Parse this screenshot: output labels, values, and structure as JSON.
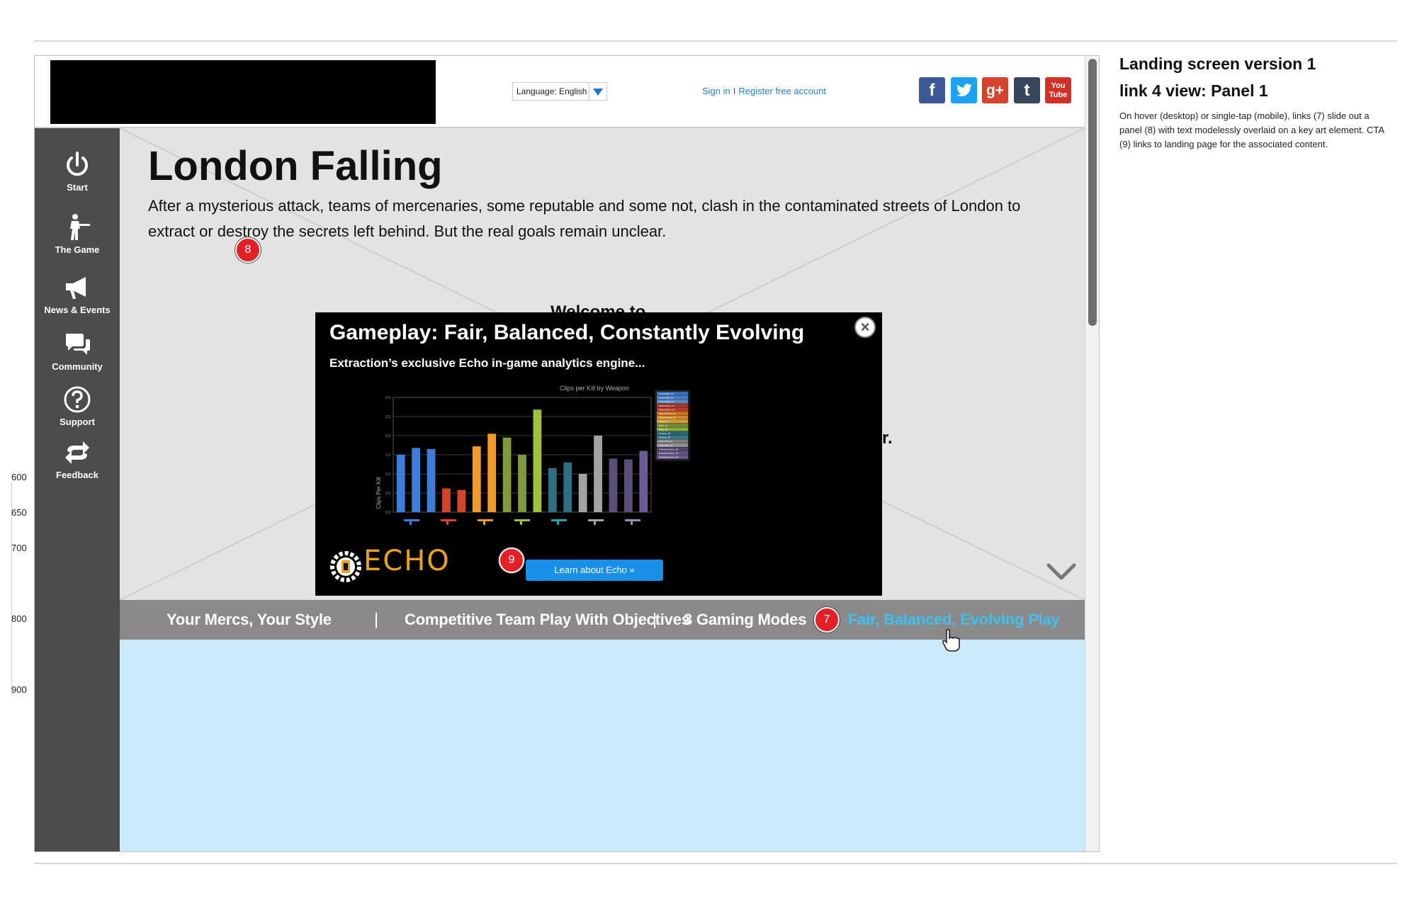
{
  "header": {
    "language_label": "Language: English",
    "sign_in": "Sign in",
    "separator": "I",
    "register": "Register free account",
    "social": {
      "facebook": "f",
      "twitter": "t",
      "googleplus": "g+",
      "tumblr": "t",
      "youtube_top": "You",
      "youtube_bottom": "Tube"
    }
  },
  "sidebar": {
    "items": [
      {
        "label": "Start",
        "icon": "power-icon"
      },
      {
        "label": "The Game",
        "icon": "soldier-icon"
      },
      {
        "label": "News & Events",
        "icon": "megaphone-icon"
      },
      {
        "label": "Community",
        "icon": "chat-icon"
      },
      {
        "label": "Support",
        "icon": "question-icon"
      },
      {
        "label": "Feedback",
        "icon": "refresh-arrows-icon"
      }
    ]
  },
  "hero": {
    "title": "London Falling",
    "description": "After a mysterious attack, teams of mercenaries, some reputable and some not, clash in the contaminated streets of London to extract or destroy the secrets left behind. But the real goals remain unclear.",
    "welcome_text": "Welcome to",
    "peek_text": "r."
  },
  "panel": {
    "title": "Gameplay: Fair, Balanced, Constantly Evolving",
    "subtitle": "Extraction’s exclusive Echo in-game analytics engine...",
    "logo_text": "ECHO",
    "cta": "Learn about Echo »",
    "badge_panel": "8",
    "badge_cta": "9"
  },
  "tabs": {
    "items": [
      {
        "label": "Your Mercs, Your Style"
      },
      {
        "label": "Competitive Team Play With Objectives"
      },
      {
        "label": "3 Gaming Modes"
      },
      {
        "label": "Fair, Balanced, Evolving Play"
      }
    ],
    "separator": "|",
    "active_badge": "7"
  },
  "ruler": [
    "600",
    "650",
    "700",
    "800",
    "900"
  ],
  "annotations": {
    "title": "Landing screen version 1",
    "subtitle": "link 4 view: Panel 1",
    "body": "On hover (desktop) or single-tap (mobile), links (7) slide out a panel (8) with text modelessly overlaid on a key art element. CTA (9) links to landing page for the associated content."
  },
  "colors": {
    "sidebar": "#4c4c4c",
    "hero_bg": "#e3e3e3",
    "tabbar": "#8a8a8a",
    "active_tab": "#3fc0ef",
    "content_bg": "#cbeafb",
    "link": "#1f7fd8",
    "badge": "#e32026",
    "cta": "#1a8fe8"
  },
  "chart_data": {
    "type": "bar",
    "title": "Clips per Kill by Weapon",
    "xlabel": "",
    "ylabel": "Clips Per Kill",
    "ylim": [
      0,
      3.0
    ],
    "yticks": [
      "0.0",
      "0.5",
      "1.0",
      "1.5",
      "2.0",
      "2.5",
      "3.0"
    ],
    "values": [
      1.5,
      1.68,
      1.65,
      0.62,
      0.58,
      1.72,
      2.05,
      1.95,
      1.5,
      2.68,
      1.15,
      1.3,
      1.0,
      2.0,
      1.4,
      1.38,
      1.6
    ],
    "colors": [
      "#3b7dd8",
      "#3b7dd8",
      "#3b7dd8",
      "#d2452c",
      "#d2452c",
      "#f19a2a",
      "#f19a2a",
      "#7f9a3d",
      "#7f9a3d",
      "#9dc23e",
      "#2f6f86",
      "#2f6f86",
      "#a3a3a3",
      "#a3a3a3",
      "#5b4f7a",
      "#5b4f7a",
      "#6b5a94"
    ],
    "weapon_colors": [
      "#3b7dd8",
      "#d2452c",
      "#f19a2a",
      "#9dc23e",
      "#2f9fb0",
      "#a3a3a3",
      "#8f8fb0"
    ],
    "legend": [
      "AssaultRifle_01",
      "AssaultRifle_02",
      "AssaultRifle_03",
      "MachineGun_01",
      "MachineGun_02",
      "MachinePistol_01",
      "MachinePistol_02",
      "Pistol_01",
      "Pistol_02",
      "Pistol_03",
      "Shotgun_01",
      "Shotgun_02",
      "SniperRifle_01",
      "SniperRifle_02",
      "SubMachineGun_01",
      "SubMachineGun_02",
      "SubMachineGun_03"
    ],
    "legend_colors": [
      "#3b7dd8",
      "#4d8ee0",
      "#5f9fe8",
      "#c0392b",
      "#d2452c",
      "#e67e22",
      "#f19a2a",
      "#f0b43c",
      "#7f9a3d",
      "#9dc23e",
      "#2f6f86",
      "#3a8a9a",
      "#8d8d8d",
      "#a3a3a3",
      "#5b4f7a",
      "#6b5a94",
      "#7b6aa4"
    ],
    "grid": true
  }
}
